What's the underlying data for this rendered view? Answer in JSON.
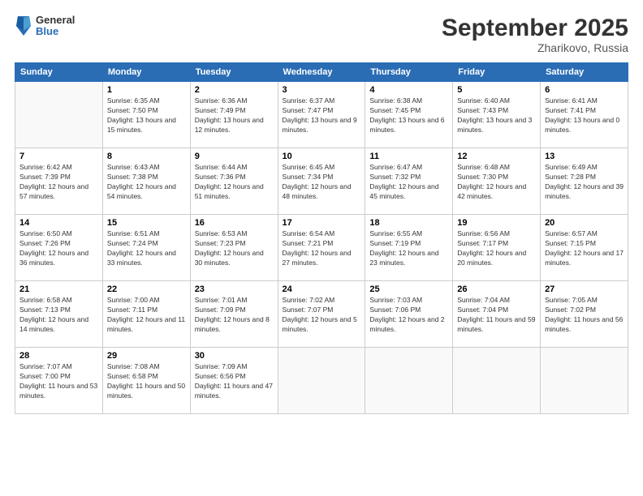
{
  "logo": {
    "general": "General",
    "blue": "Blue"
  },
  "header": {
    "month": "September 2025",
    "location": "Zharikovo, Russia"
  },
  "weekdays": [
    "Sunday",
    "Monday",
    "Tuesday",
    "Wednesday",
    "Thursday",
    "Friday",
    "Saturday"
  ],
  "weeks": [
    [
      {
        "day": "",
        "sunrise": "",
        "sunset": "",
        "daylight": ""
      },
      {
        "day": "1",
        "sunrise": "Sunrise: 6:35 AM",
        "sunset": "Sunset: 7:50 PM",
        "daylight": "Daylight: 13 hours and 15 minutes."
      },
      {
        "day": "2",
        "sunrise": "Sunrise: 6:36 AM",
        "sunset": "Sunset: 7:49 PM",
        "daylight": "Daylight: 13 hours and 12 minutes."
      },
      {
        "day": "3",
        "sunrise": "Sunrise: 6:37 AM",
        "sunset": "Sunset: 7:47 PM",
        "daylight": "Daylight: 13 hours and 9 minutes."
      },
      {
        "day": "4",
        "sunrise": "Sunrise: 6:38 AM",
        "sunset": "Sunset: 7:45 PM",
        "daylight": "Daylight: 13 hours and 6 minutes."
      },
      {
        "day": "5",
        "sunrise": "Sunrise: 6:40 AM",
        "sunset": "Sunset: 7:43 PM",
        "daylight": "Daylight: 13 hours and 3 minutes."
      },
      {
        "day": "6",
        "sunrise": "Sunrise: 6:41 AM",
        "sunset": "Sunset: 7:41 PM",
        "daylight": "Daylight: 13 hours and 0 minutes."
      }
    ],
    [
      {
        "day": "7",
        "sunrise": "Sunrise: 6:42 AM",
        "sunset": "Sunset: 7:39 PM",
        "daylight": "Daylight: 12 hours and 57 minutes."
      },
      {
        "day": "8",
        "sunrise": "Sunrise: 6:43 AM",
        "sunset": "Sunset: 7:38 PM",
        "daylight": "Daylight: 12 hours and 54 minutes."
      },
      {
        "day": "9",
        "sunrise": "Sunrise: 6:44 AM",
        "sunset": "Sunset: 7:36 PM",
        "daylight": "Daylight: 12 hours and 51 minutes."
      },
      {
        "day": "10",
        "sunrise": "Sunrise: 6:45 AM",
        "sunset": "Sunset: 7:34 PM",
        "daylight": "Daylight: 12 hours and 48 minutes."
      },
      {
        "day": "11",
        "sunrise": "Sunrise: 6:47 AM",
        "sunset": "Sunset: 7:32 PM",
        "daylight": "Daylight: 12 hours and 45 minutes."
      },
      {
        "day": "12",
        "sunrise": "Sunrise: 6:48 AM",
        "sunset": "Sunset: 7:30 PM",
        "daylight": "Daylight: 12 hours and 42 minutes."
      },
      {
        "day": "13",
        "sunrise": "Sunrise: 6:49 AM",
        "sunset": "Sunset: 7:28 PM",
        "daylight": "Daylight: 12 hours and 39 minutes."
      }
    ],
    [
      {
        "day": "14",
        "sunrise": "Sunrise: 6:50 AM",
        "sunset": "Sunset: 7:26 PM",
        "daylight": "Daylight: 12 hours and 36 minutes."
      },
      {
        "day": "15",
        "sunrise": "Sunrise: 6:51 AM",
        "sunset": "Sunset: 7:24 PM",
        "daylight": "Daylight: 12 hours and 33 minutes."
      },
      {
        "day": "16",
        "sunrise": "Sunrise: 6:53 AM",
        "sunset": "Sunset: 7:23 PM",
        "daylight": "Daylight: 12 hours and 30 minutes."
      },
      {
        "day": "17",
        "sunrise": "Sunrise: 6:54 AM",
        "sunset": "Sunset: 7:21 PM",
        "daylight": "Daylight: 12 hours and 27 minutes."
      },
      {
        "day": "18",
        "sunrise": "Sunrise: 6:55 AM",
        "sunset": "Sunset: 7:19 PM",
        "daylight": "Daylight: 12 hours and 23 minutes."
      },
      {
        "day": "19",
        "sunrise": "Sunrise: 6:56 AM",
        "sunset": "Sunset: 7:17 PM",
        "daylight": "Daylight: 12 hours and 20 minutes."
      },
      {
        "day": "20",
        "sunrise": "Sunrise: 6:57 AM",
        "sunset": "Sunset: 7:15 PM",
        "daylight": "Daylight: 12 hours and 17 minutes."
      }
    ],
    [
      {
        "day": "21",
        "sunrise": "Sunrise: 6:58 AM",
        "sunset": "Sunset: 7:13 PM",
        "daylight": "Daylight: 12 hours and 14 minutes."
      },
      {
        "day": "22",
        "sunrise": "Sunrise: 7:00 AM",
        "sunset": "Sunset: 7:11 PM",
        "daylight": "Daylight: 12 hours and 11 minutes."
      },
      {
        "day": "23",
        "sunrise": "Sunrise: 7:01 AM",
        "sunset": "Sunset: 7:09 PM",
        "daylight": "Daylight: 12 hours and 8 minutes."
      },
      {
        "day": "24",
        "sunrise": "Sunrise: 7:02 AM",
        "sunset": "Sunset: 7:07 PM",
        "daylight": "Daylight: 12 hours and 5 minutes."
      },
      {
        "day": "25",
        "sunrise": "Sunrise: 7:03 AM",
        "sunset": "Sunset: 7:06 PM",
        "daylight": "Daylight: 12 hours and 2 minutes."
      },
      {
        "day": "26",
        "sunrise": "Sunrise: 7:04 AM",
        "sunset": "Sunset: 7:04 PM",
        "daylight": "Daylight: 11 hours and 59 minutes."
      },
      {
        "day": "27",
        "sunrise": "Sunrise: 7:05 AM",
        "sunset": "Sunset: 7:02 PM",
        "daylight": "Daylight: 11 hours and 56 minutes."
      }
    ],
    [
      {
        "day": "28",
        "sunrise": "Sunrise: 7:07 AM",
        "sunset": "Sunset: 7:00 PM",
        "daylight": "Daylight: 11 hours and 53 minutes."
      },
      {
        "day": "29",
        "sunrise": "Sunrise: 7:08 AM",
        "sunset": "Sunset: 6:58 PM",
        "daylight": "Daylight: 11 hours and 50 minutes."
      },
      {
        "day": "30",
        "sunrise": "Sunrise: 7:09 AM",
        "sunset": "Sunset: 6:56 PM",
        "daylight": "Daylight: 11 hours and 47 minutes."
      },
      {
        "day": "",
        "sunrise": "",
        "sunset": "",
        "daylight": ""
      },
      {
        "day": "",
        "sunrise": "",
        "sunset": "",
        "daylight": ""
      },
      {
        "day": "",
        "sunrise": "",
        "sunset": "",
        "daylight": ""
      },
      {
        "day": "",
        "sunrise": "",
        "sunset": "",
        "daylight": ""
      }
    ]
  ]
}
